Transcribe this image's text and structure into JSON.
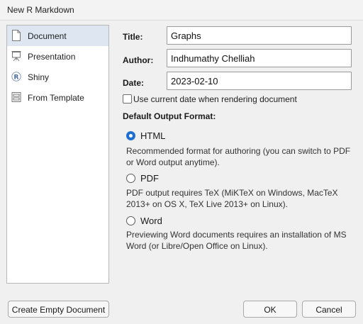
{
  "window": {
    "title": "New R Markdown"
  },
  "sidebar": {
    "items": [
      {
        "label": "Document",
        "icon": "document-icon",
        "selected": true
      },
      {
        "label": "Presentation",
        "icon": "presentation-icon",
        "selected": false
      },
      {
        "label": "Shiny",
        "icon": "shiny-r-icon",
        "selected": false
      },
      {
        "label": "From Template",
        "icon": "template-icon",
        "selected": false
      }
    ]
  },
  "form": {
    "title_label": "Title:",
    "title_value": "Graphs",
    "author_label": "Author:",
    "author_value": "Indhumathy Chelliah",
    "date_label": "Date:",
    "date_value": "2023-02-10",
    "use_current_date_label": "Use current date when rendering document",
    "use_current_date_checked": false
  },
  "output": {
    "section_label": "Default Output Format:",
    "selected": "HTML",
    "options": [
      {
        "label": "HTML",
        "desc_line1": "Recommended format for authoring (you can switch to PDF",
        "desc_line2": "or Word output anytime)."
      },
      {
        "label": "PDF",
        "desc_line1": "PDF output requires TeX (MiKTeX on Windows, MacTeX",
        "desc_line2": "2013+ on OS X, TeX Live 2013+ on Linux)."
      },
      {
        "label": "Word",
        "desc_line1": "Previewing Word documents requires an installation of MS",
        "desc_line2": "Word (or Libre/Open Office on Linux)."
      }
    ]
  },
  "buttons": {
    "create_empty": "Create Empty Document",
    "ok": "OK",
    "cancel": "Cancel"
  },
  "colors": {
    "selected_bg": "#dde6f1",
    "radio_accent": "#1f6fd0"
  }
}
